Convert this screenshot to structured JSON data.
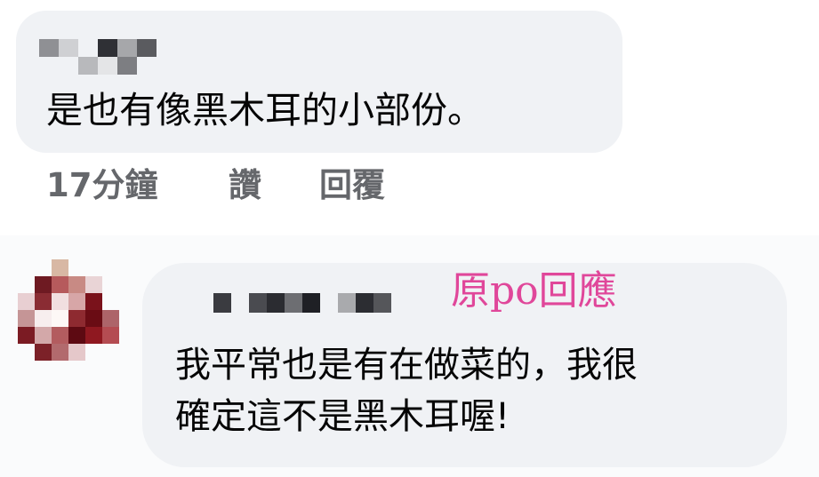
{
  "comment": {
    "text": "是也有像黑木耳的小部份。",
    "actions": {
      "time": "17分鐘",
      "like": "讚",
      "reply": "回覆"
    }
  },
  "reply": {
    "annotation": "原po回應",
    "text_lines": [
      "我平常也是有在做菜的，我很",
      "確定這不是黑木耳喔!"
    ]
  },
  "colors": {
    "bubble": "#f0f2f5",
    "text": "#050505",
    "secondary_text": "#65676b",
    "annotation": "#e0479a"
  }
}
